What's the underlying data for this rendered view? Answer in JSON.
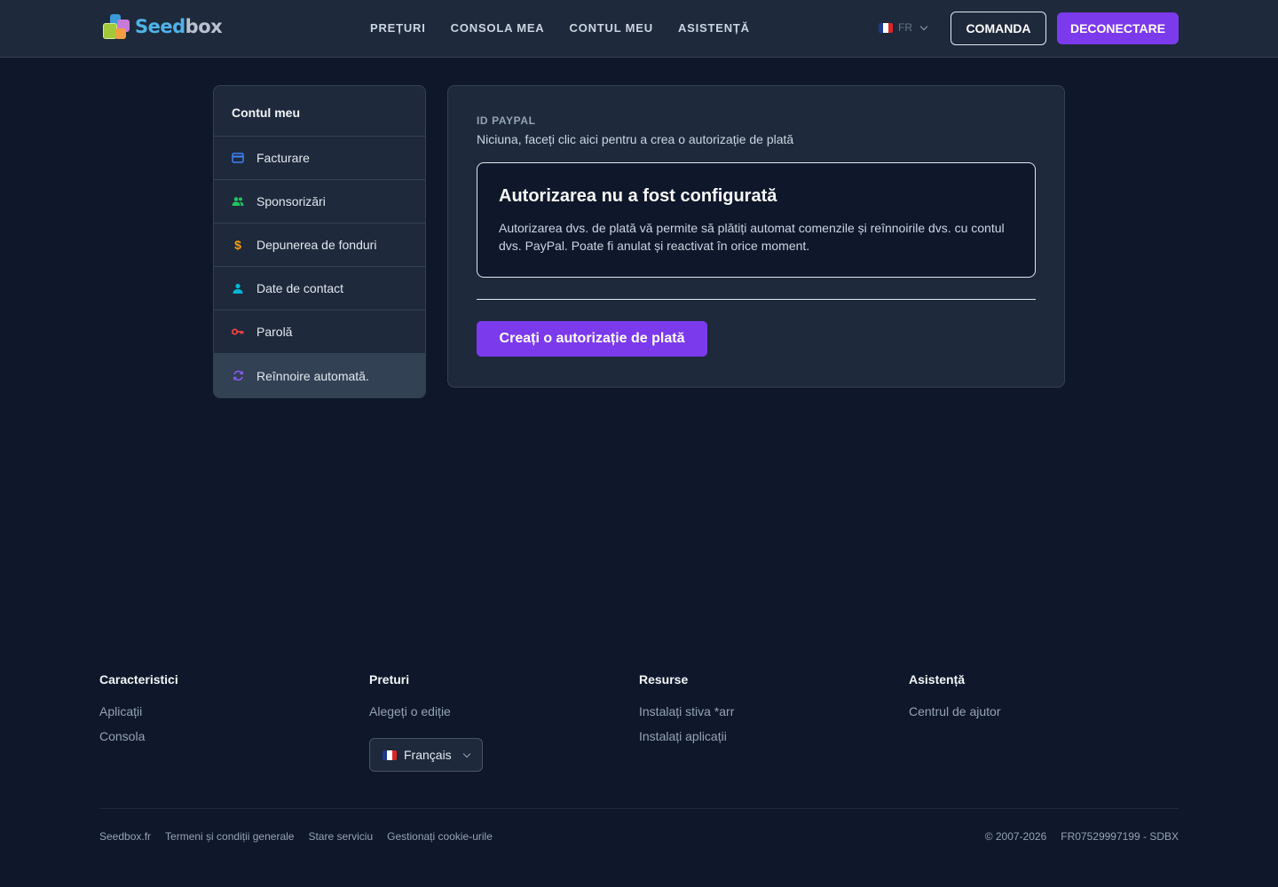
{
  "header": {
    "logo_text_1": "Seed",
    "logo_text_2": "box",
    "nav": [
      "PREȚURI",
      "CONSOLA MEA",
      "CONTUL MEU",
      "ASISTENȚĂ"
    ],
    "lang_code": "FR",
    "order_label": "COMANDA",
    "logout_label": "DECONECTARE"
  },
  "sidebar": {
    "title": "Contul meu",
    "items": [
      {
        "label": "Facturare",
        "icon": "credit-card-icon",
        "color": "#3b82f6"
      },
      {
        "label": "Sponsorizări",
        "icon": "users-icon",
        "color": "#22c55e"
      },
      {
        "label": "Depunerea de fonduri",
        "icon": "dollar-icon",
        "color": "#f59e0b"
      },
      {
        "label": "Date de contact",
        "icon": "user-icon",
        "color": "#06b6d4"
      },
      {
        "label": "Parolă",
        "icon": "key-icon",
        "color": "#ef4444"
      },
      {
        "label": "Reînnoire automată.",
        "icon": "refresh-icon",
        "color": "#8b5cf6"
      }
    ]
  },
  "main": {
    "paypal_label": "ID PAYPAL",
    "paypal_value": "Niciuna, faceți clic aici pentru a crea o autorizație de plată",
    "notice_title": "Autorizarea nu a fost configurată",
    "notice_text": "Autorizarea dvs. de plată vă permite să plătiți automat comenzile și reînnoirile dvs. cu contul dvs. PayPal. Poate fi anulat și reactivat în orice moment.",
    "create_button": "Creați o autorizație de plată"
  },
  "footer": {
    "cols": [
      {
        "title": "Caracteristici",
        "links": [
          "Aplicații",
          "Consola"
        ]
      },
      {
        "title": "Preturi",
        "links": [
          "Alegeți o ediție"
        ]
      },
      {
        "title": "Resurse",
        "links": [
          "Instalați stiva *arr",
          "Instalați aplicații"
        ]
      },
      {
        "title": "Asistență",
        "links": [
          "Centrul de ajutor"
        ]
      }
    ],
    "language": "Français",
    "bottom_links": [
      "Seedbox.fr",
      "Termeni și condiții generale",
      "Stare serviciu",
      "Gestionați cookie-urile"
    ],
    "copyright": "© 2007-2026",
    "company_id": "FR07529997199 - SDBX"
  },
  "colors": {
    "accent": "#7c3aed",
    "background": "#0f172a",
    "panel": "#1e293b"
  }
}
